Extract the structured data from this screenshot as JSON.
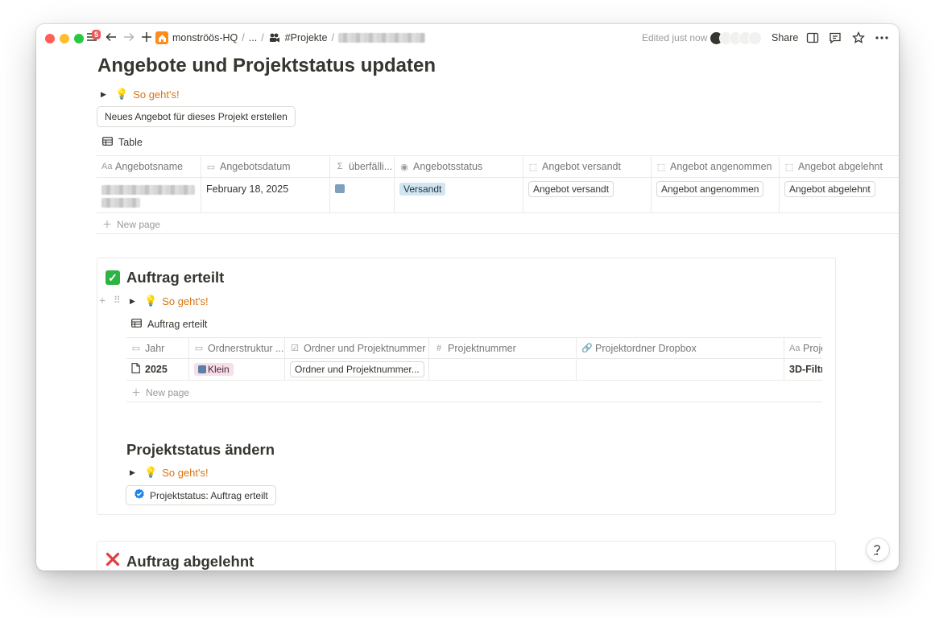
{
  "topbar": {
    "notification_count": "5",
    "breadcrumbs": [
      "monströös-HQ",
      "...",
      "#Projekte"
    ],
    "edited": "Edited just now",
    "share": "Share"
  },
  "page": {
    "title": "Angebote und Projektstatus updaten",
    "toggle_label": "So geht's!",
    "new_offer_button": "Neues Angebot für dieses Projekt erstellen",
    "view_label": "Table"
  },
  "offers_table": {
    "headers": [
      "Angebotsname",
      "Angebotsdatum",
      "überfälli...",
      "Angebotsstatus",
      "Angebot versandt",
      "Angebot angenommen",
      "Angebot abgelehnt"
    ],
    "row": {
      "date": "February 18, 2025",
      "status": "Versandt",
      "btn_sent": "Angebot versandt",
      "btn_accepted": "Angebot angenommen",
      "btn_rejected": "Angebot abgelehnt"
    },
    "new_page": "New page"
  },
  "callout_accepted": {
    "heading": "Auftrag erteilt",
    "toggle_label": "So geht's!",
    "view_label": "Auftrag erteilt",
    "table": {
      "headers": [
        "Jahr",
        "Ordnerstruktur ...",
        "Ordner und Projektnummer",
        "Projektnummer",
        "Projektordner Dropbox",
        "Proje"
      ],
      "row": {
        "year": "2025",
        "size": "Klein",
        "folder_btn": "Ordner und Projektnummer...",
        "name": "3D-Filtr"
      },
      "new_page": "New page"
    },
    "status_heading": "Projektstatus ändern",
    "status_toggle": "So geht's!",
    "status_button": "Projektstatus: Auftrag erteilt"
  },
  "callout_rejected": {
    "heading": "Auftrag abgelehnt"
  },
  "help": "?"
}
